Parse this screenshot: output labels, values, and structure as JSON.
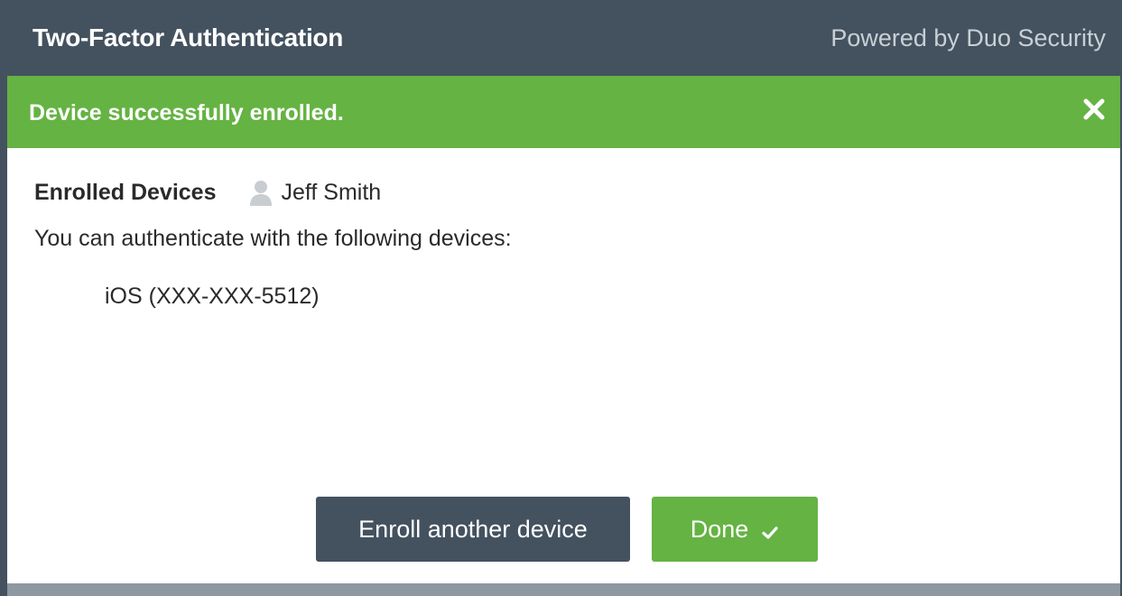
{
  "header": {
    "title": "Two-Factor Authentication",
    "powered_by": "Powered by Duo Security"
  },
  "banner": {
    "message": "Device successfully enrolled.",
    "close_icon": "close-icon",
    "color": "#65b343"
  },
  "enrolled": {
    "title": "Enrolled Devices",
    "user_icon": "user-icon",
    "user_name": "Jeff Smith",
    "description": "You can authenticate with the following devices:",
    "devices": [
      "iOS (XXX-XXX-5512)"
    ]
  },
  "actions": {
    "enroll_label": "Enroll another device",
    "done_label": "Done",
    "done_icon": "check-icon"
  },
  "colors": {
    "header": "#44525f",
    "success": "#65b343",
    "text": "#2a2a2a"
  }
}
